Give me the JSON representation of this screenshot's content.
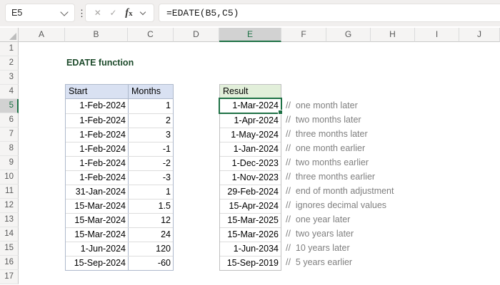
{
  "formula_bar": {
    "name_box": "E5",
    "formula": "=EDATE(B5,C5)",
    "cancel_icon": "✕",
    "enter_icon": "✓"
  },
  "sheet": {
    "column_headers": [
      "A",
      "B",
      "C",
      "D",
      "E",
      "F",
      "G",
      "H",
      "I",
      "J"
    ],
    "row_numbers": [
      "1",
      "2",
      "3",
      "4",
      "5",
      "6",
      "7",
      "8",
      "9",
      "10",
      "11",
      "12",
      "13",
      "14",
      "15",
      "16",
      "17"
    ],
    "selected_cell": {
      "column": "E",
      "row": "5"
    }
  },
  "content": {
    "title": "EDATE function",
    "table": {
      "start_header": "Start",
      "months_header": "Months",
      "result_header": "Result",
      "rows": [
        {
          "start": "1-Feb-2024",
          "months": "1",
          "result": "1-Mar-2024",
          "comment": "//  one month later"
        },
        {
          "start": "1-Feb-2024",
          "months": "2",
          "result": "1-Apr-2024",
          "comment": "//  two months later"
        },
        {
          "start": "1-Feb-2024",
          "months": "3",
          "result": "1-May-2024",
          "comment": "//  three months later"
        },
        {
          "start": "1-Feb-2024",
          "months": "-1",
          "result": "1-Jan-2024",
          "comment": "//  one month earlier"
        },
        {
          "start": "1-Feb-2024",
          "months": "-2",
          "result": "1-Dec-2023",
          "comment": "//  two months earlier"
        },
        {
          "start": "1-Feb-2024",
          "months": "-3",
          "result": "1-Nov-2023",
          "comment": "//  three months earlier"
        },
        {
          "start": "31-Jan-2024",
          "months": "1",
          "result": "29-Feb-2024",
          "comment": "//  end of month adjustment"
        },
        {
          "start": "15-Mar-2024",
          "months": "1.5",
          "result": "15-Apr-2024",
          "comment": "//  ignores decimal values"
        },
        {
          "start": "15-Mar-2024",
          "months": "12",
          "result": "15-Mar-2025",
          "comment": "//  one year later"
        },
        {
          "start": "15-Mar-2024",
          "months": "24",
          "result": "15-Mar-2026",
          "comment": "//  two years later"
        },
        {
          "start": "1-Jun-2024",
          "months": "120",
          "result": "1-Jun-2034",
          "comment": "//  10 years later"
        },
        {
          "start": "15-Sep-2024",
          "months": "-60",
          "result": "15-Sep-2019",
          "comment": "//  5 years earlier"
        }
      ]
    }
  },
  "colors": {
    "selection_green": "#1E7145",
    "header_sel_bg": "#D2D2D2",
    "table1_header_bg": "#D9E1F2",
    "table2_header_bg": "#E2EFDA",
    "table1_border": "#AEB9CC",
    "table2_border": "#BFBFBF",
    "comment_gray": "#7F7F7F",
    "title_color": "#1C4A2A"
  }
}
